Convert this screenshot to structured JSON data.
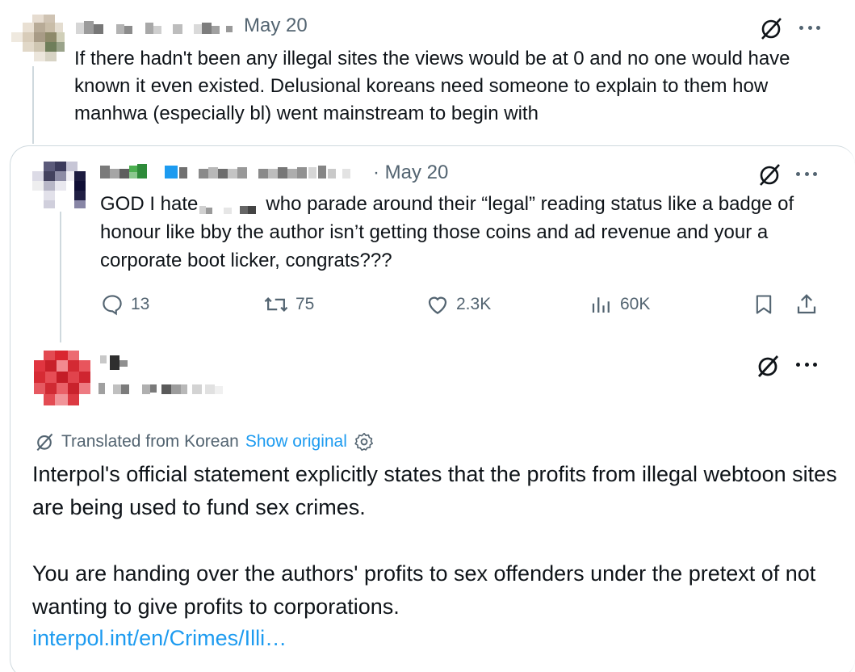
{
  "tweet1": {
    "date": "May 20",
    "text": "If there hadn't been any illegal sites the views would be at 0 and no one would have known it even existed. Delusional koreans need someone to explain to them how manhwa (especially bl) went mainstream to begin with"
  },
  "quoted": {
    "date": "· May 20",
    "text_before": "GOD I hate",
    "text_after": "who parade around their “legal” reading status like a badge of honour like bby the author isn’t getting those coins and ad revenue and your a corporate boot licker, congrats???",
    "stats": {
      "replies": "13",
      "reposts": "75",
      "likes": "2.3K",
      "views": "60K"
    }
  },
  "tweet3": {
    "translated_label": "Translated from Korean",
    "show_original": "Show original",
    "paragraph1": "Interpol's official statement explicitly states that the profits from illegal webtoon sites are being used to fund sex crimes.",
    "paragraph2": "You are handing over the authors' profits to sex offenders under the pretext of not wanting to give profits to corporations.",
    "link": "interpol.int/en/Crimes/Illi…"
  },
  "icons": {
    "grok": "grok-icon",
    "more": "more-icon",
    "reply": "reply-icon",
    "repost": "repost-icon",
    "like": "like-icon",
    "views": "views-icon",
    "bookmark": "bookmark-icon",
    "share": "share-icon",
    "settings": "gear-icon"
  },
  "colors": {
    "text": "#0f1419",
    "secondary": "#536471",
    "link": "#1d9bf0",
    "border": "#cfd9de"
  }
}
